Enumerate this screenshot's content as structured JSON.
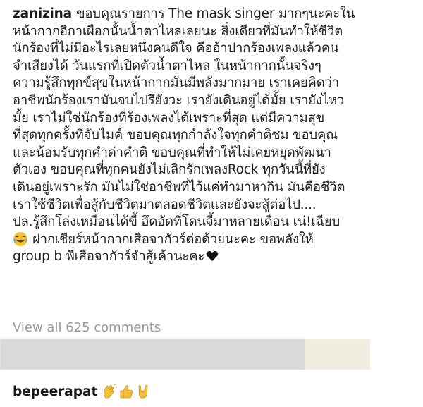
{
  "post": {
    "username": "zanizina",
    "caption_lines": [
      "ขอบคุณรายการ The mask singer มากๆนะคะใน",
      "หน้ากากอีกาเผือกนั้นน้ำตาไหลเลยนะ สิ่งเดียวที่มันทำให้ชีวิต",
      "นักร้องที่ไม่มีอะไรเลยหนึ่งคนดีใจ คืออ้าปากร้องเพลงแล้วคน",
      "จำเสียงได้ วันแรกที่เปิดตัวน้ำตาไหล ในหน้ากากนั้นจริงๆ",
      "ความรู้สึกทุกข์สุขในหน้ากากมันมีพลังมากมาย เราเคยคิดว่า",
      "อาชีพนักร้องเรามันจบไปรึยังวะ เรายังเดินอยู่ได้มั้ย เรายังไหว",
      "มั้ย เราไม่ใช่นักร้องที่ร้องเพลงได้เพราะที่สุด แต่มีความสุข",
      "ที่สุดทุกครั้งที่จับไมค์ ขอบคุณทุกกำลังใจทุกคำติชม ขอบคุณ",
      "และน้อมรับทุกคำด่าคำติ ขอบคุณที่ทำให้ไม่เคยหยุดพัฒนา",
      "ตัวเอง ขอบคุณที่ทุกคนยังไม่เลิกรักเพลงRock ทุกวันนี้ที่ยัง",
      "เดินอยู่เพราะรัก มันไม่ใช่อาชีพที่ไว้แค่ทำมาหากิน มันคือชีวิต",
      "เราใช้ชีวิตเพื่อสู้กับชีวิตมาตลอดชีวิตและยังจะสู้ต่อไป....",
      "ปล.รู้สึกโล่งเหมือนได้ขี้ อึดอัดที่โดนจี้มาหลายเดือน เน่!เฉียบ"
    ],
    "caption_line_14": "ฝากเชียร์หน้ากากเสือจากัวร์ต่อด้วยนะคะ ขอพลังให้",
    "caption_line_15": "group b พี่เสือจากัวร์จำสู้เค้านะคะ",
    "icons": {
      "laugh": "face-with-tears-of-joy-icon",
      "heart": "black-heart-icon"
    }
  },
  "comments": {
    "view_all": "View all 625 comments"
  },
  "comment": {
    "username": "bepeerapat",
    "icons": [
      "clapping-hands-icon",
      "thumbs-up-icon",
      "rock-on-hand-icon"
    ]
  },
  "colors": {
    "text": "#1f1f1f",
    "muted": "#9a9a9a",
    "emoji_yellow": "#f5c13a",
    "blur_gray": "#d9d9d9"
  }
}
